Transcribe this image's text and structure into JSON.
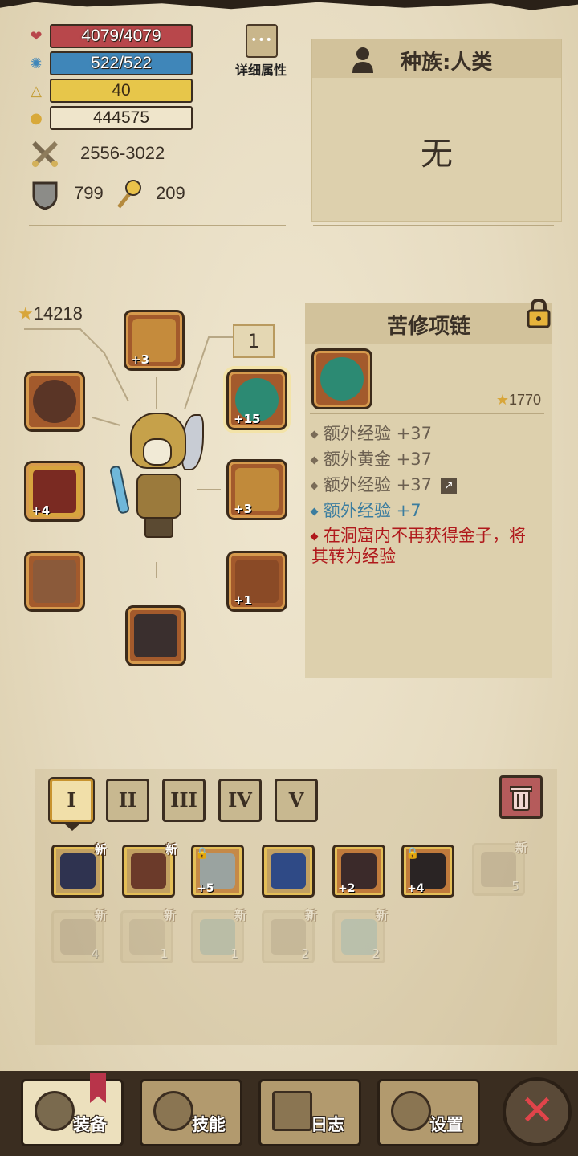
{
  "stats": {
    "hp": "4079/4079",
    "mp": "522/522",
    "level": "40",
    "gold": "444575",
    "attack": "2556-3022",
    "armor": "799",
    "magic": "209"
  },
  "detail_button": {
    "dots": "•••",
    "label": "详细属性"
  },
  "race": {
    "title": "种族:人类",
    "value": "无"
  },
  "equipment": {
    "score": "14218",
    "tier_badge": "1",
    "slots": [
      {
        "name": "helmet",
        "plus": "+3"
      },
      {
        "name": "whip",
        "plus": ""
      },
      {
        "name": "necklace",
        "plus": "+15"
      },
      {
        "name": "bracer",
        "plus": "+4"
      },
      {
        "name": "armor",
        "plus": "+3"
      },
      {
        "name": "gauntlet",
        "plus": ""
      },
      {
        "name": "belt",
        "plus": "+1"
      },
      {
        "name": "boots",
        "plus": ""
      }
    ]
  },
  "item": {
    "title": "苦修项链",
    "stars": "1770",
    "attrs": [
      {
        "text": "额外经验 +37"
      },
      {
        "text": "额外黄金 +37"
      },
      {
        "text": "额外经验 +37"
      },
      {
        "text": "额外经验 +7"
      },
      {
        "text": "在洞窟内不再获得金子，将其转为经验"
      }
    ]
  },
  "tabs": [
    "I",
    "II",
    "III",
    "IV",
    "V"
  ],
  "inventory": {
    "row1": [
      {
        "new": "新",
        "plus": "",
        "count": "",
        "locked": false,
        "faded": false
      },
      {
        "new": "新",
        "plus": "",
        "count": "",
        "locked": false,
        "faded": false
      },
      {
        "new": "",
        "plus": "+5",
        "count": "",
        "locked": true,
        "faded": false
      },
      {
        "new": "",
        "plus": "",
        "count": "",
        "locked": false,
        "faded": false
      },
      {
        "new": "",
        "plus": "+2",
        "count": "",
        "locked": false,
        "faded": false
      },
      {
        "new": "",
        "plus": "+4",
        "count": "",
        "locked": true,
        "faded": false
      },
      {
        "new": "新",
        "plus": "",
        "count": "5",
        "locked": false,
        "faded": true
      }
    ],
    "row2": [
      {
        "new": "新",
        "count": "4"
      },
      {
        "new": "新",
        "count": "1"
      },
      {
        "new": "新",
        "count": "1"
      },
      {
        "new": "新",
        "count": "2"
      },
      {
        "new": "新",
        "count": "2"
      }
    ]
  },
  "nav": {
    "equip": "装备",
    "skills": "技能",
    "log": "日志",
    "settings": "设置",
    "close": "✕"
  },
  "colors": {
    "hp": "#b8474b",
    "mp": "#3f86b9",
    "level": "#e7c64a",
    "blue_attr": "#3b7d9f",
    "red_attr": "#b0191c"
  }
}
